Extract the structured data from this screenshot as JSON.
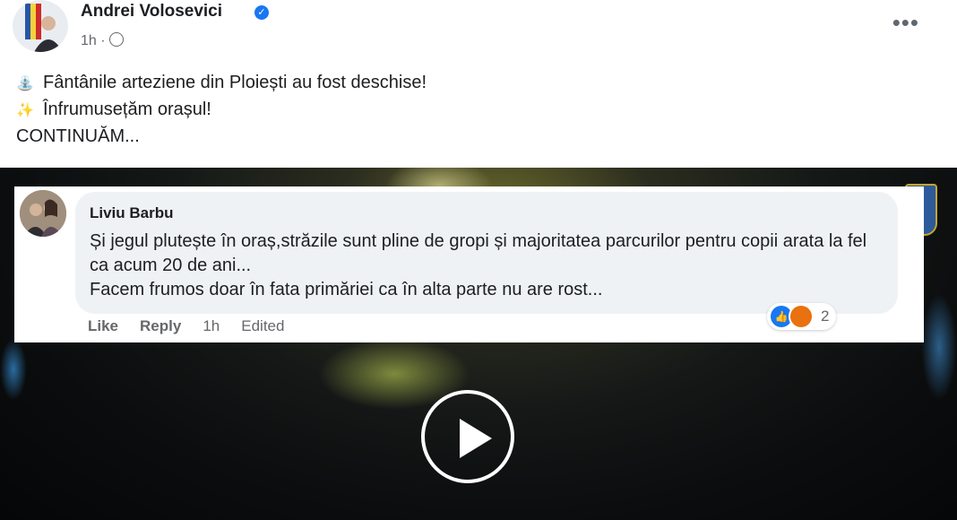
{
  "post": {
    "author": "Andrei Volosevici",
    "time": "1h ·",
    "more_label": "•••",
    "lines": [
      {
        "emoji": "⛲",
        "text": "Fântânile arteziene din Ploiești au fost deschise!"
      },
      {
        "emoji": "✨",
        "text": "Înfrumusețăm orașul!"
      },
      {
        "emoji": "",
        "text": "CONTINUĂM..."
      }
    ]
  },
  "comment": {
    "author": "Liviu Barbu",
    "text": "Și jegul plutește în oraș,străzile sunt pline de gropi și majoritatea parcurilor pentru copii arata la fel ca acum 20 de ani...\nFacem frumos doar în fata primăriei ca în alta parte nu are rost...",
    "reaction_count": "2",
    "actions": {
      "like": "Like",
      "reply": "Reply",
      "time": "1h",
      "edited": "Edited"
    }
  },
  "colors": {
    "accent": "#1877f2",
    "angry": "#e9710f",
    "bubble": "#eff2f5"
  }
}
